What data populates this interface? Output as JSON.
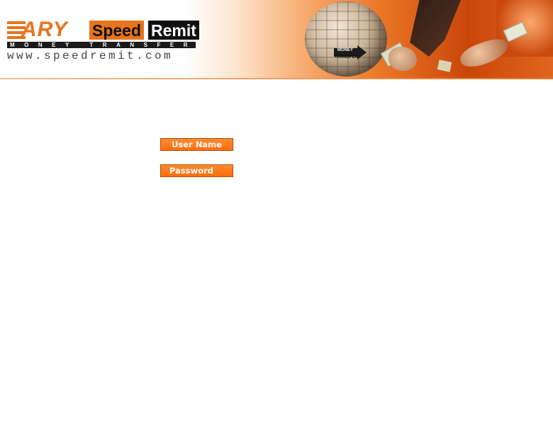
{
  "header": {
    "logo": {
      "ary": "ARY",
      "speed": "Speed",
      "remit": "Remit",
      "tagline": "MONEY TRANSFER",
      "url": "www.speedremit.com"
    },
    "globe_label_top": "MONEY",
    "globe_label_bottom": "TRANSFER",
    "brand_color": "#e8741d"
  },
  "login": {
    "username_label": "User Name",
    "password_label": "Password",
    "label_color": "#ff6d0c"
  }
}
